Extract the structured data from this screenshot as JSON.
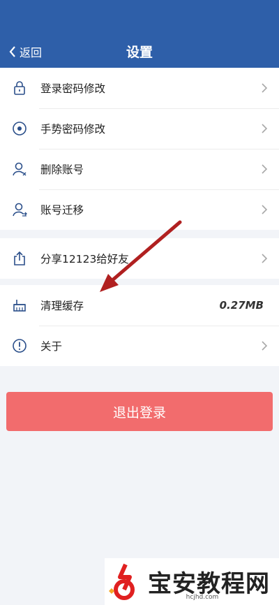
{
  "header": {
    "back_label": "返回",
    "title": "设置"
  },
  "groups": {
    "account": [
      {
        "label": "登录密码修改",
        "icon": "lock-icon"
      },
      {
        "label": "手势密码修改",
        "icon": "gesture-icon"
      },
      {
        "label": "删除账号",
        "icon": "user-remove-icon"
      },
      {
        "label": "账号迁移",
        "icon": "user-transfer-icon"
      }
    ],
    "share": [
      {
        "label": "分享12123给好友",
        "icon": "share-icon"
      }
    ],
    "other": [
      {
        "label": "清理缓存",
        "icon": "broom-icon",
        "value": "0.27MB"
      },
      {
        "label": "关于",
        "icon": "info-icon"
      }
    ]
  },
  "logout_label": "退出登录",
  "watermark": {
    "title": "宝安教程网",
    "url": "hcjhd.com"
  },
  "colors": {
    "header": "#2e5fa9",
    "logout": "#f26c6d",
    "arrow": "#b02020"
  }
}
